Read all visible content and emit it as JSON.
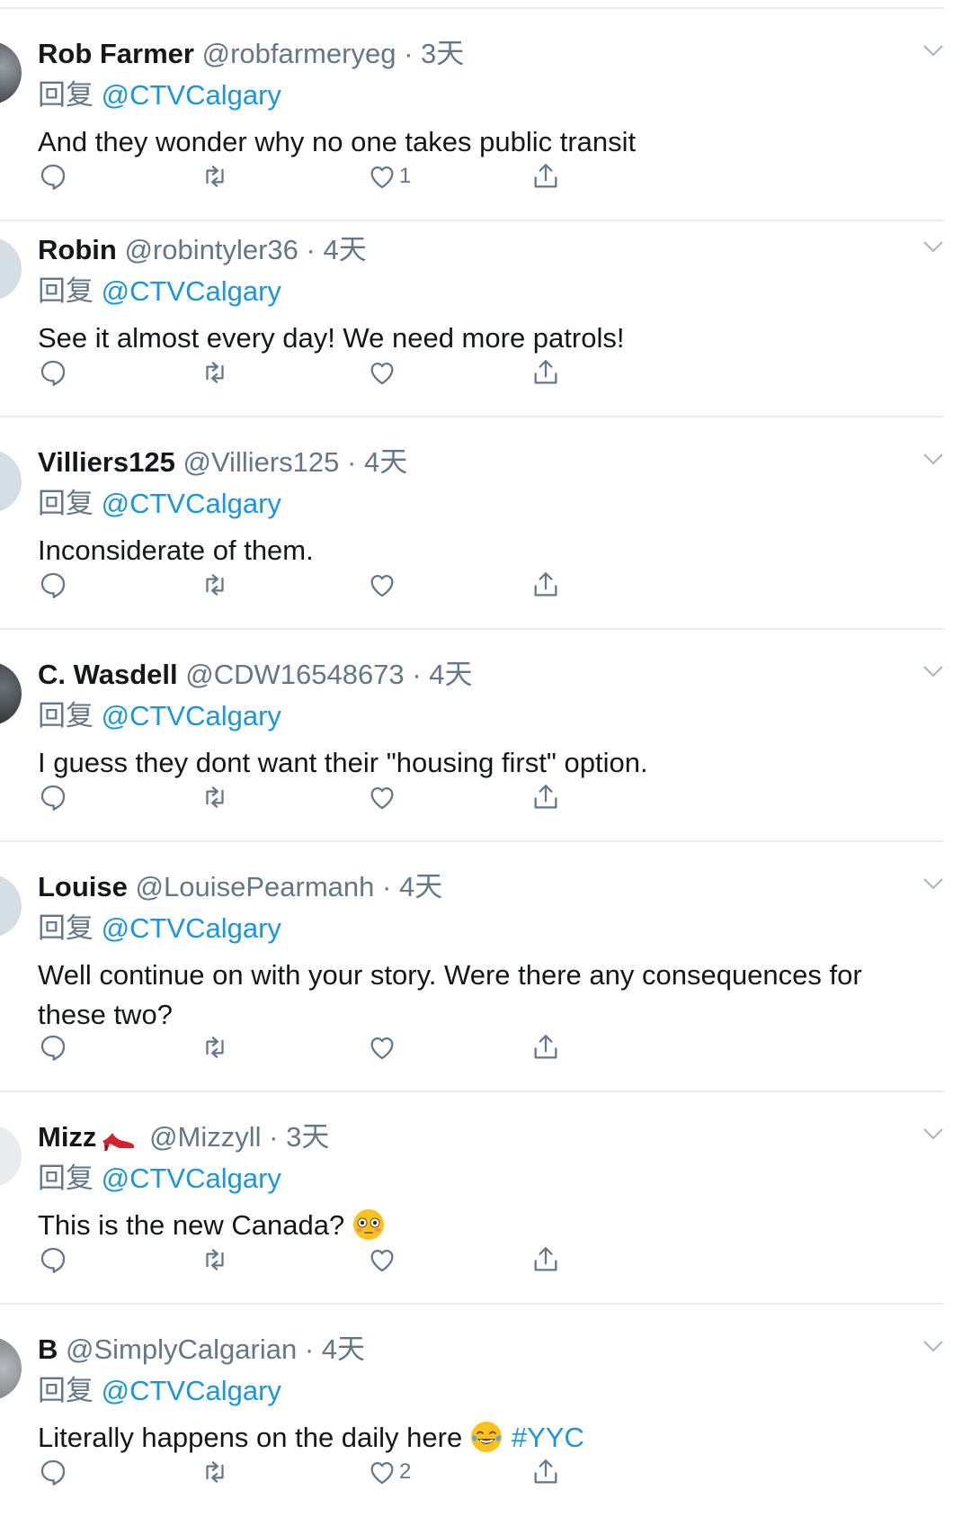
{
  "reply_prefix": "回复",
  "accent_color": "#1b95e0",
  "tweets": [
    {
      "name": "Rob Farmer",
      "handle": "@robfarmeryeg",
      "time": "3天",
      "reply_to": "@CTVCalgary",
      "text": "And they wonder why no one takes public transit",
      "likes": "1"
    },
    {
      "name": "Robin",
      "handle": "@robintyler36",
      "time": "4天",
      "reply_to": "@CTVCalgary",
      "text": "See it almost every day! We need more patrols!",
      "likes": ""
    },
    {
      "name": "Villiers125",
      "handle": "@Villiers125",
      "time": "4天",
      "reply_to": "@CTVCalgary",
      "text": "Inconsiderate of them.",
      "likes": ""
    },
    {
      "name": "C. Wasdell",
      "handle": "@CDW16548673",
      "time": "4天",
      "reply_to": "@CTVCalgary",
      "text": "I guess they dont want their \"housing first\" option.",
      "likes": ""
    },
    {
      "name": "Louise",
      "handle": "@LouisePearmanh",
      "time": "4天",
      "reply_to": "@CTVCalgary",
      "text": "Well continue on with your story. Were there any consequences for these two?",
      "likes": ""
    },
    {
      "name": "Mizz",
      "name_icon": "high-heel-emoji",
      "handle": "@Mizzyll",
      "time": "3天",
      "reply_to": "@CTVCalgary",
      "text": "This is the new Canada?",
      "text_emoji": "flushed-face-emoji",
      "likes": ""
    },
    {
      "name": "B",
      "handle": "@SimplyCalgarian",
      "time": "4天",
      "reply_to": "@CTVCalgary",
      "text": "Literally happens on the daily here",
      "text_emoji": "tears-of-joy-emoji",
      "hashtag": "#YYC",
      "likes": "2"
    }
  ]
}
